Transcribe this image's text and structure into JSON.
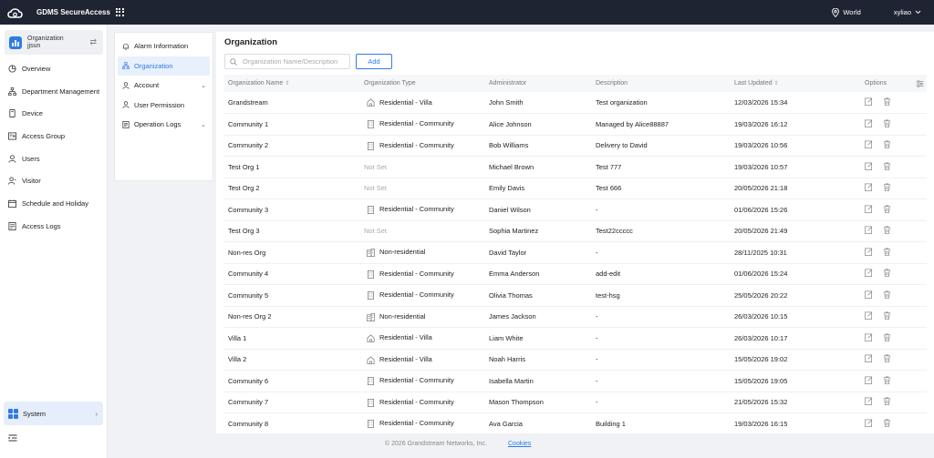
{
  "app": {
    "title": "GDMS SecureAccess",
    "region": "World",
    "user": "xyliao"
  },
  "org_switch": {
    "label": "Organization",
    "name": "jjsun"
  },
  "nav": [
    {
      "label": "Overview",
      "icon": "pie-chart-icon"
    },
    {
      "label": "Department Management",
      "icon": "hierarchy-icon"
    },
    {
      "label": "Device",
      "icon": "device-icon"
    },
    {
      "label": "Access Group",
      "icon": "access-group-icon"
    },
    {
      "label": "Users",
      "icon": "user-icon"
    },
    {
      "label": "Visitor",
      "icon": "visitor-icon"
    },
    {
      "label": "Schedule and Holiday",
      "icon": "calendar-icon"
    },
    {
      "label": "Access Logs",
      "icon": "logs-icon"
    }
  ],
  "system": {
    "label": "System"
  },
  "submenu": [
    {
      "label": "Alarm Information"
    },
    {
      "label": "Organization"
    },
    {
      "label": "Account"
    },
    {
      "label": "User Permission"
    },
    {
      "label": "Operation Logs"
    }
  ],
  "main": {
    "title": "Organization",
    "search_placeholder": "Organization Name/Description",
    "add_label": "Add",
    "columns": [
      "Organization Name",
      "Organization Type",
      "Administrator",
      "Description",
      "Last Updated",
      "Options"
    ],
    "rows": [
      {
        "name": "Grandstream",
        "type": "Residential - Villa",
        "admin": "John Smith",
        "desc": "Test organization",
        "updated": "12/03/2026 15:34"
      },
      {
        "name": "Community 1",
        "type": "Residential - Community",
        "admin": "Alice Johnson",
        "desc": "Managed by Alice88887",
        "updated": "19/03/2026 16:12"
      },
      {
        "name": "Community 2",
        "type": "Residential - Community",
        "admin": "Bob Williams",
        "desc": "Delivery to David",
        "updated": "19/03/2026 10:56"
      },
      {
        "name": "Test Org 1",
        "type": "Not Set",
        "admin": "Michael Brown",
        "desc": "Test 777",
        "updated": "19/03/2026 10:57"
      },
      {
        "name": "Test Org 2",
        "type": "Not Set",
        "admin": "Emily Davis",
        "desc": "Test 666",
        "updated": "20/05/2026 21:18"
      },
      {
        "name": "Community 3",
        "type": "Residential - Community",
        "admin": "Daniel Wilson",
        "desc": "-",
        "updated": "01/06/2026 15:26"
      },
      {
        "name": "Test Org 3",
        "type": "Not Set",
        "admin": "Sophia Martinez",
        "desc": "Test22ccccc",
        "updated": "20/05/2026 21:49"
      },
      {
        "name": "Non-res Org",
        "type": "Non-residential",
        "admin": "David Taylor",
        "desc": "-",
        "updated": "28/11/2025 10:31"
      },
      {
        "name": "Community 4",
        "type": "Residential - Community",
        "admin": "Emma Anderson",
        "desc": "add-edit",
        "updated": "01/06/2026 15:24"
      },
      {
        "name": "Community 5",
        "type": "Residential - Community",
        "admin": "Olivia Thomas",
        "desc": "test-hsg",
        "updated": "25/05/2026 20:22"
      },
      {
        "name": "Non-res Org 2",
        "type": "Non-residential",
        "admin": "James Jackson",
        "desc": "-",
        "updated": "26/03/2026 10:15"
      },
      {
        "name": "Villa 1",
        "type": "Residential - Villa",
        "admin": "Liam White",
        "desc": "-",
        "updated": "26/03/2026 10:17"
      },
      {
        "name": "Villa 2",
        "type": "Residential - Villa",
        "admin": "Noah Harris",
        "desc": "-",
        "updated": "15/05/2026 19:02"
      },
      {
        "name": "Community 6",
        "type": "Residential - Community",
        "admin": "Isabella Martin",
        "desc": "-",
        "updated": "15/05/2026 19:05"
      },
      {
        "name": "Community 7",
        "type": "Residential - Community",
        "admin": "Mason Thompson",
        "desc": "-",
        "updated": "21/05/2026 15:32"
      },
      {
        "name": "Community 8",
        "type": "Residential - Community",
        "admin": "Ava Garcia",
        "desc": "Building 1",
        "updated": "19/03/2026 16:15"
      }
    ]
  },
  "footer": {
    "copyright": "© 2026 Grandstream Networks, Inc.",
    "cookies": "Cookies"
  },
  "colors": {
    "topbar": "#1f2433",
    "accent": "#2f7be6"
  }
}
